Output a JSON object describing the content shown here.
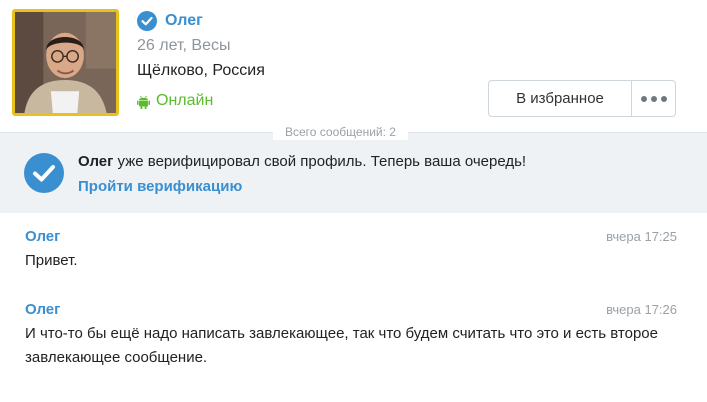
{
  "profile": {
    "name": "Олег",
    "age_sign": "26 лет, Весы",
    "location": "Щёлково, Россия",
    "status": "Онлайн",
    "favorite_button": "В избранное",
    "colors": {
      "accent": "#3a8fd0",
      "online": "#5cbb2e",
      "avatar_border": "#e8c21a"
    },
    "icons": [
      "verified-check-icon",
      "android-icon",
      "more-dots-icon"
    ]
  },
  "messages_count_label": "Всего сообщений: 2",
  "verification": {
    "name": "Олег",
    "text": " уже верифицировал свой профиль. Теперь ваша очередь!",
    "link": "Пройти верификацию"
  },
  "messages": [
    {
      "author": "Олег",
      "time": "вчера 17:25",
      "text": "Привет."
    },
    {
      "author": "Олег",
      "time": "вчера 17:26",
      "text": "И что-то бы ещё надо написать завлекающее, так что будем считать что это и есть второе завлекающее сообщение."
    }
  ]
}
